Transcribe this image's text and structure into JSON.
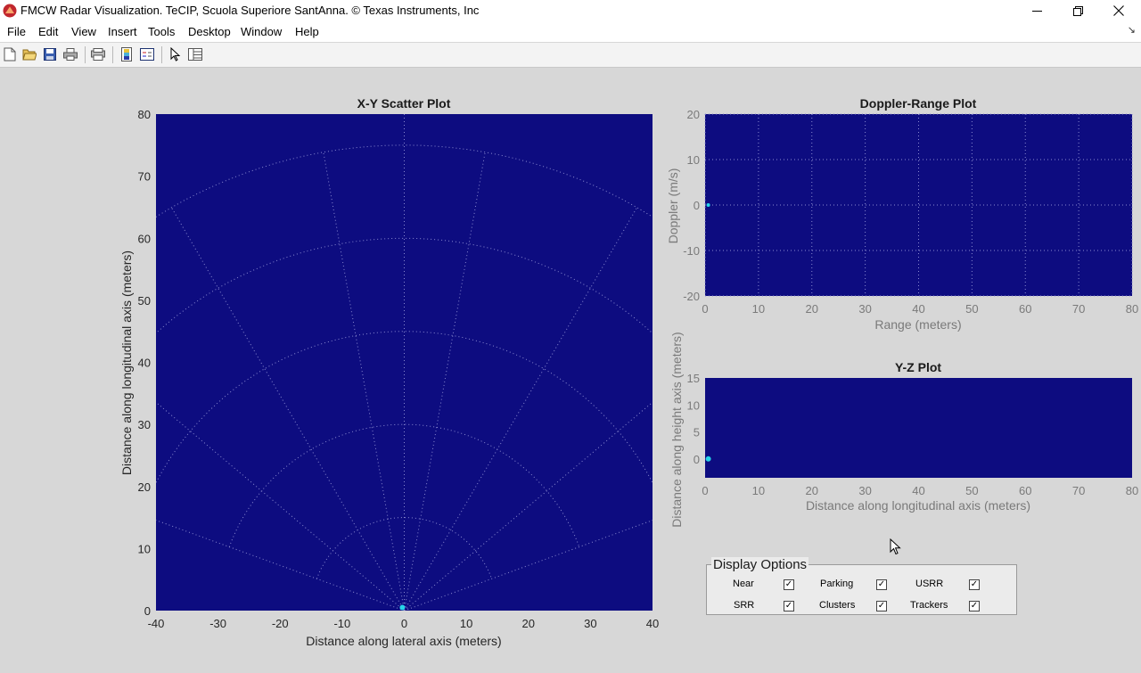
{
  "window": {
    "title": "FMCW Radar Visualization. TeCIP, Scuola Superiore SantAnna. © Texas Instruments, Inc"
  },
  "menu": [
    "File",
    "Edit",
    "View",
    "Insert",
    "Tools",
    "Desktop",
    "Window",
    "Help"
  ],
  "toolbar": [
    "new-figure-icon",
    "open-file-icon",
    "save-icon",
    "print-icon",
    "print-preview-icon",
    "colorbar-icon",
    "legend-icon",
    "edit-plot-arrow-icon",
    "property-inspector-icon"
  ],
  "colors": {
    "plot_bg": "#0d0c80",
    "grid": "#8a8ad0",
    "point": "#26d4e8"
  },
  "chart_data": [
    {
      "type": "scatter",
      "title": "X-Y Scatter Plot",
      "xlabel": "Distance along lateral axis (meters)",
      "ylabel": "Distance along longitudinal axis (meters)",
      "xlim": [
        -40,
        40
      ],
      "ylim": [
        0,
        80
      ],
      "xticks": [
        "-40",
        "-30",
        "-20",
        "-10",
        "0",
        "10",
        "20",
        "30",
        "40"
      ],
      "yticks": [
        "0",
        "10",
        "20",
        "30",
        "40",
        "50",
        "60",
        "70",
        "80"
      ],
      "polar_grid": {
        "radii": [
          15,
          30,
          45,
          60,
          75
        ],
        "angles_deg": [
          -70,
          -50,
          -30,
          -10,
          10,
          30,
          50,
          70
        ],
        "arc_span_deg": [
          -70,
          70
        ]
      },
      "points": [
        {
          "x": -0.3,
          "y": 0.5
        }
      ]
    },
    {
      "type": "scatter",
      "title": "Doppler-Range Plot",
      "xlabel": "Range (meters)",
      "ylabel": "Doppler (m/s)",
      "xlim": [
        0,
        80
      ],
      "ylim": [
        -20,
        20
      ],
      "xticks": [
        "0",
        "10",
        "20",
        "30",
        "40",
        "50",
        "60",
        "70",
        "80"
      ],
      "yticks": [
        "-20",
        "-10",
        "0",
        "10",
        "20"
      ],
      "grid": true,
      "points": [
        {
          "x": 0.6,
          "y": 0
        }
      ]
    },
    {
      "type": "scatter",
      "title": "Y-Z Plot",
      "xlabel": "Distance along longitudinal axis (meters)",
      "ylabel": "Distance along height axis (meters)",
      "xlim": [
        0,
        80
      ],
      "ylim": [
        -3.5,
        15
      ],
      "xticks": [
        "0",
        "10",
        "20",
        "30",
        "40",
        "50",
        "60",
        "70",
        "80"
      ],
      "yticks": [
        "0",
        "5",
        "10",
        "15"
      ],
      "grid": false,
      "points": [
        {
          "x": 0.6,
          "y": 0
        }
      ]
    }
  ],
  "display_options": {
    "title": "Display Options",
    "items": [
      {
        "label": "Near",
        "checked": true
      },
      {
        "label": "Parking",
        "checked": true
      },
      {
        "label": "USRR",
        "checked": true
      },
      {
        "label": "SRR",
        "checked": true
      },
      {
        "label": "Clusters",
        "checked": true
      },
      {
        "label": "Trackers",
        "checked": true
      }
    ]
  }
}
